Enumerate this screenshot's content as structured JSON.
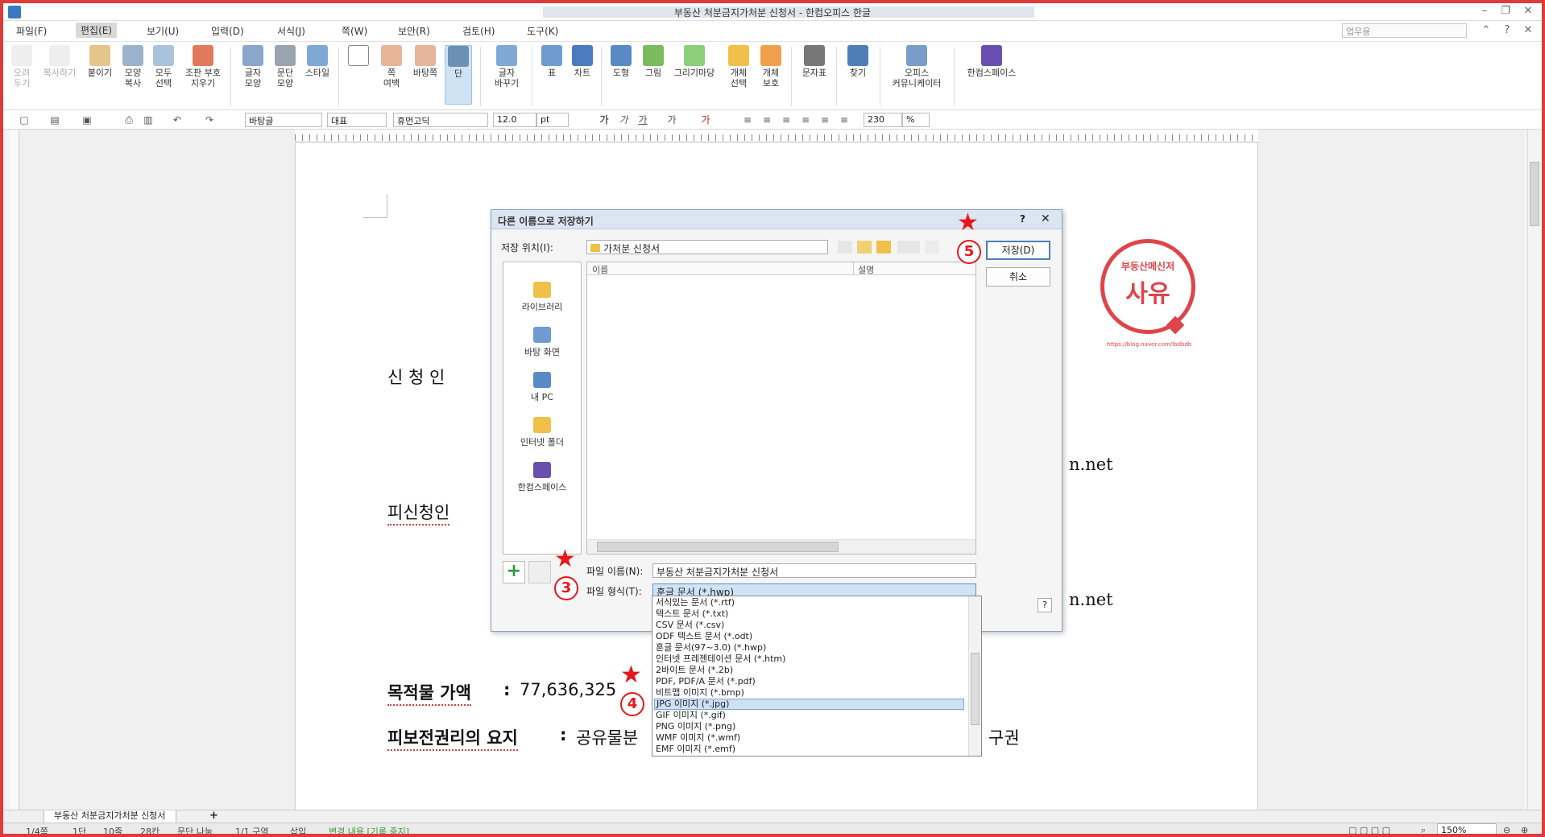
{
  "window": {
    "title": "부동산 처분금지가처분 신청서 - 한컴오피스 한글",
    "doc_mode": "업무용"
  },
  "menus": [
    "파일(F)",
    "편집(E)",
    "보기(U)",
    "입력(D)",
    "서식(J)",
    "쪽(W)",
    "보안(R)",
    "검토(H)",
    "도구(K)"
  ],
  "ribbon": {
    "cut": "오려\n두기",
    "copy": "복사하기",
    "paste": "붙이기",
    "format_copy": "모양\n복사",
    "select_all": "모두\n선택",
    "clear": "조판 부호\n지우기",
    "char_shape": "글자\n모양",
    "para_shape": "문단\n모양",
    "style": "스타일",
    "page_margin": "쪽\n여백",
    "background": "바탕쪽",
    "column": "단",
    "char_change": "글자\n바꾸기",
    "table": "표",
    "chart": "차트",
    "shape": "도형",
    "picture": "그림",
    "draw": "그리기마당",
    "obj_select": "개체\n선택",
    "obj_protect": "개체\n보호",
    "symbol": "문자표",
    "find": "찾기",
    "office_comm": "오피스\n커뮤니케이터",
    "hancom_space": "한컴스페이스"
  },
  "toolbar": {
    "style": "바탕글",
    "lang": "대표",
    "font": "휴먼고딕",
    "size": "12.0",
    "unit": "pt",
    "zoom": "230",
    "zoom_unit": "%"
  },
  "document": {
    "applicant": "신 청 인",
    "respondent": "피신청인",
    "net1": "n.net",
    "net2": "n.net",
    "value_label": "목적물 가액",
    "value_colon": ":",
    "value": "77,636,325",
    "right_label": "피보전권리의 요지",
    "right_colon": ":",
    "right_text": "공유물분",
    "right_tail": "구권"
  },
  "stamp": {
    "top": "부동산메신저",
    "main": "사유",
    "url": "https://blog.naver.com/lbdbdb"
  },
  "dialog": {
    "title": "다른 이름으로 저장하기",
    "help": "?",
    "close": "✕",
    "location_label": "저장 위치(I):",
    "location_value": "가처분 신청서",
    "save": "저장(D)",
    "cancel": "취소",
    "places": [
      "라이브러리",
      "바탕 화면",
      "내 PC",
      "인터넷 폴더",
      "한컴스페이스"
    ],
    "col_name": "이름",
    "col_desc": "설명",
    "filename_label": "파일 이름(N):",
    "filename_value": "부동산 처분금지가처분 신청서",
    "filetype_label": "파일 형식(T):",
    "filetype_value": "훈글 문서 (*.hwp)",
    "help_small": "?"
  },
  "dropdown_options": [
    "서식있는 문서 (*.rtf)",
    "텍스트 문서 (*.txt)",
    "CSV 문서 (*.csv)",
    "ODF 텍스트 문서 (*.odt)",
    "훈글 문서(97~3.0) (*.hwp)",
    "인터넷 프레젠테이션 문서 (*.htm)",
    "2바이트 문서 (*.2b)",
    "PDF, PDF/A 문서 (*.pdf)",
    "비트맵 이미지 (*.bmp)",
    "JPG 이미지 (*.jpg)",
    "GIF 이미지 (*.gif)",
    "PNG 이미지 (*.png)",
    "WMF 이미지 (*.wmf)",
    "EMF 이미지 (*.emf)"
  ],
  "annotations": {
    "n3": "3",
    "n4": "4",
    "n5": "5",
    "star": "★"
  },
  "tabs": {
    "doc": "부동산 처분금지가처분 신청서",
    "add": "+"
  },
  "status": {
    "page": "1/4쪽",
    "col": "1단",
    "line": "10줄",
    "char": "28칸",
    "para": "문단 나눔",
    "section": "1/1 구역",
    "insert": "삽입",
    "track": "변경 내용 [기록 중지]",
    "zoom": "150%"
  },
  "colors": {
    "accent_red": "#e8171d",
    "frame_border": "#e03a3a",
    "dialog_title": "#dbe6f2",
    "highlight": "#cfe0f3"
  }
}
